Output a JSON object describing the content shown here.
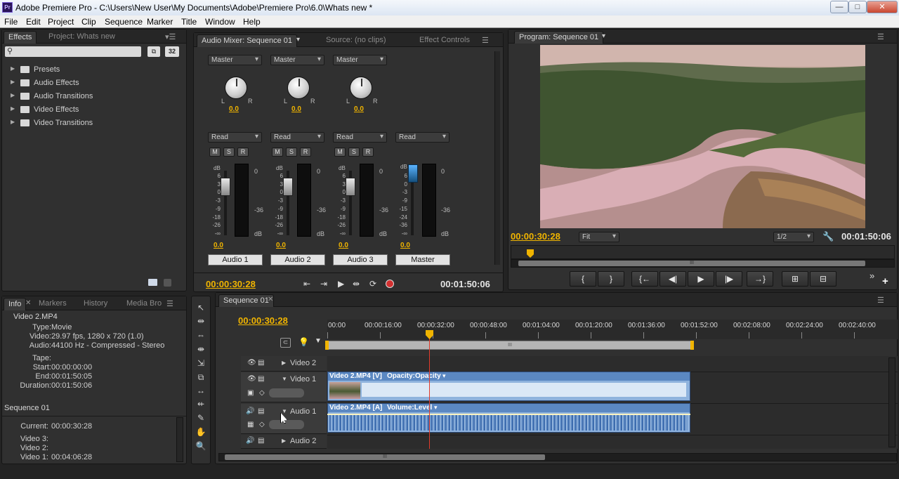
{
  "window": {
    "title": "Adobe Premiere Pro - C:\\Users\\New User\\My Documents\\Adobe\\Premiere Pro\\6.0\\Whats new *",
    "icon": "Pr",
    "min": "—",
    "max": "□",
    "close": "✕"
  },
  "menu": [
    "File",
    "Edit",
    "Project",
    "Clip",
    "Sequence",
    "Marker",
    "Title",
    "Window",
    "Help"
  ],
  "effects_panel": {
    "tabs": [
      "Effects",
      "Project: Whats new"
    ],
    "search_placeholder": "",
    "badges": [
      "32"
    ],
    "items": [
      "Presets",
      "Audio Effects",
      "Audio Transitions",
      "Video Effects",
      "Video Transitions"
    ]
  },
  "mixer": {
    "tabs": [
      "Audio Mixer: Sequence 01",
      "Source: (no clips)",
      "Effect Controls"
    ],
    "channels": [
      {
        "output": "Master",
        "pan": "0.0",
        "mode": "Read",
        "level": "0.0",
        "name": "Audio 1"
      },
      {
        "output": "Master",
        "pan": "0.0",
        "mode": "Read",
        "level": "0.0",
        "name": "Audio 2"
      },
      {
        "output": "Master",
        "pan": "0.0",
        "mode": "Read",
        "level": "0.0",
        "name": "Audio 3"
      },
      {
        "output": "",
        "pan": "",
        "mode": "Read",
        "level": "0.0",
        "name": "Master"
      }
    ],
    "msr": [
      "M",
      "S",
      "R"
    ],
    "db_label": "dB",
    "fader_scale": [
      "6",
      "3",
      "0",
      "-3",
      "-9",
      "-18",
      "-26",
      "-∞"
    ],
    "master_scale": [
      "6",
      "0",
      "-3",
      "-9",
      "-15",
      "-24",
      "-36",
      "-∞"
    ],
    "meter_scale": [
      "0",
      "-36",
      "dB"
    ],
    "pan_l": "L",
    "pan_r": "R",
    "current_time": "00:00:30:28",
    "duration": "00:01:50:06"
  },
  "program": {
    "tab": "Program: Sequence 01",
    "current_time": "00:00:30:28",
    "zoom": "Fit",
    "resolution": "1/2",
    "duration": "00:01:50:06",
    "buttons": [
      "{",
      "}",
      "{←",
      "◀|",
      "▶",
      "|▶",
      "→}",
      "⊞",
      "⊟"
    ],
    "more": "»",
    "add": "+"
  },
  "info_panel": {
    "tabs": [
      "Info",
      "Markers",
      "History",
      "Media Bro"
    ],
    "clip": "Video 2.MP4",
    "rows": [
      {
        "label": "Type:",
        "value": "Movie"
      },
      {
        "label": "Video:",
        "value": "29.97 fps, 1280 x 720 (1.0)"
      },
      {
        "label": "Audio:",
        "value": "44100 Hz - Compressed - Stereo"
      },
      {
        "label": "",
        "value": ""
      },
      {
        "label": "Tape:",
        "value": ""
      },
      {
        "label": "Start:",
        "value": "00:00:00:00"
      },
      {
        "label": "End:",
        "value": "00:01:50:05"
      },
      {
        "label": "Duration:",
        "value": "00:01:50:06"
      }
    ],
    "sequence": "Sequence 01",
    "seq_rows": [
      {
        "label": "Current:",
        "value": "00:00:30:28"
      },
      {
        "label": "Video 3:",
        "value": ""
      },
      {
        "label": "Video 2:",
        "value": ""
      },
      {
        "label": "Video 1:",
        "value": "00:04:06:28"
      }
    ]
  },
  "timeline": {
    "tab": "Sequence 01",
    "current_time": "00:00:30:28",
    "ruler": [
      "00:00",
      "00:00:16:00",
      "00:00:32:00",
      "00:00:48:00",
      "00:01:04:00",
      "00:01:20:00",
      "00:01:36:00",
      "00:01:52:00",
      "00:02:08:00",
      "00:02:24:00",
      "00:02:40:00"
    ],
    "tracks": [
      "Video 2",
      "Video 1",
      "Audio 1",
      "Audio 2"
    ],
    "clips": {
      "video": "Video 2.MP4 [V]",
      "video_effect": "Opacity:Opacity",
      "audio": "Video 2.MP4 [A]",
      "audio_effect": "Volume:Level"
    },
    "scroll_label": "III",
    "playhead_fraction": 0.278
  },
  "tools": [
    "↖",
    "⇹",
    "⇔",
    "⇼",
    "⇲",
    "⧉",
    "↔",
    "⇷",
    "✎",
    "✋",
    "🔍"
  ],
  "colors": {
    "accent": "#f0b400",
    "clip_blue": "#8fb3dd",
    "playhead": "#e23b2b"
  }
}
